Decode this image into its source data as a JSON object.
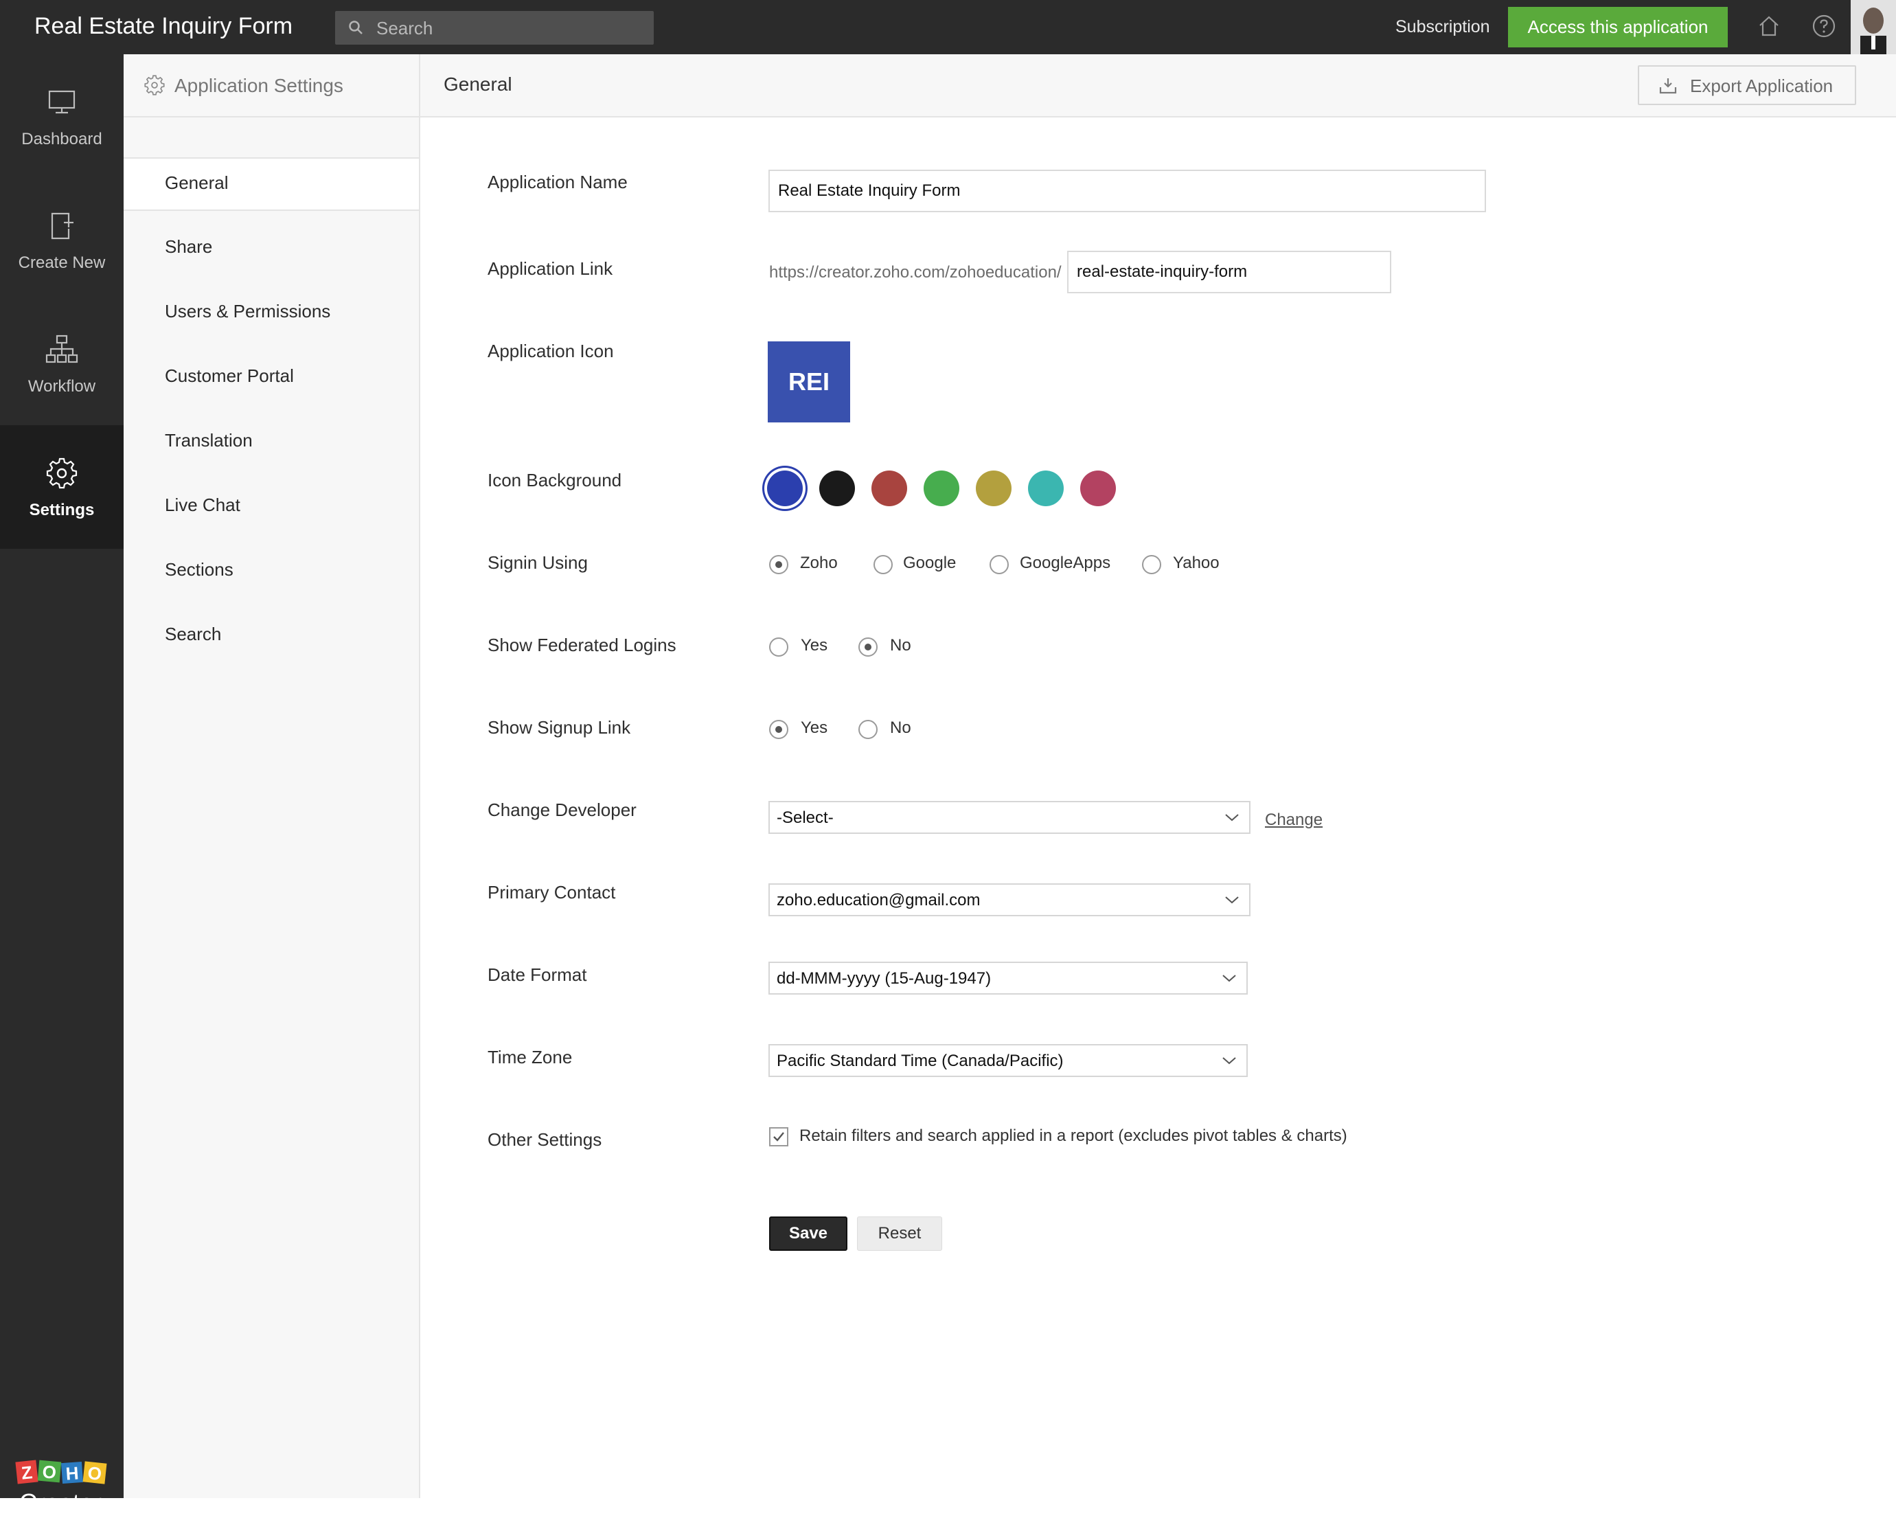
{
  "header": {
    "app_title": "Real Estate Inquiry Form",
    "search_placeholder": "Search",
    "subscription_label": "Subscription",
    "access_button_label": "Access this application",
    "home_icon": "home-icon",
    "help_icon": "help-icon"
  },
  "rail": {
    "items": [
      {
        "label": "Dashboard",
        "icon": "monitor-icon"
      },
      {
        "label": "Create New",
        "icon": "new-page-icon"
      },
      {
        "label": "Workflow",
        "icon": "workflow-icon"
      },
      {
        "label": "Settings",
        "icon": "gear-icon",
        "active": true
      }
    ],
    "logo_text": "Creator",
    "logo_letters": "ZOHO"
  },
  "sidebar": {
    "title": "Application Settings",
    "items": [
      {
        "label": "General",
        "active": true
      },
      {
        "label": "Share"
      },
      {
        "label": "Users & Permissions"
      },
      {
        "label": "Customer Portal"
      },
      {
        "label": "Translation"
      },
      {
        "label": "Live Chat"
      },
      {
        "label": "Sections"
      },
      {
        "label": "Search"
      }
    ]
  },
  "main": {
    "title": "General",
    "export_label": "Export Application"
  },
  "form": {
    "app_name": {
      "label": "Application Name",
      "value": "Real Estate Inquiry Form"
    },
    "app_link": {
      "label": "Application Link",
      "prefix": "https://creator.zoho.com/zohoeducation/",
      "value": "real-estate-inquiry-form"
    },
    "app_icon": {
      "label": "Application Icon",
      "text": "REI",
      "color": "#3951ae"
    },
    "icon_bg": {
      "label": "Icon Background",
      "colors": [
        "#2b3fae",
        "#1a1a1a",
        "#a8443f",
        "#47ad4e",
        "#b3a03e",
        "#3bb6b0",
        "#b34261"
      ],
      "selected": 0
    },
    "signin": {
      "label": "Signin Using",
      "options": [
        "Zoho",
        "Google",
        "GoogleApps",
        "Yahoo"
      ],
      "selected": "Zoho"
    },
    "federated": {
      "label": "Show Federated Logins",
      "options": [
        "Yes",
        "No"
      ],
      "selected": "No"
    },
    "signup": {
      "label": "Show Signup Link",
      "options": [
        "Yes",
        "No"
      ],
      "selected": "Yes"
    },
    "developer": {
      "label": "Change Developer",
      "value": "-Select-",
      "link": "Change"
    },
    "contact": {
      "label": "Primary Contact",
      "value": "zoho.education@gmail.com"
    },
    "date_format": {
      "label": "Date Format",
      "value": "dd-MMM-yyyy (15-Aug-1947)"
    },
    "time_zone": {
      "label": "Time Zone",
      "value": "Pacific Standard Time (Canada/Pacific)"
    },
    "other": {
      "label": "Other Settings",
      "checkbox_label": "Retain filters and search applied in a report (excludes pivot tables & charts)",
      "checked": true
    },
    "save_label": "Save",
    "reset_label": "Reset"
  }
}
